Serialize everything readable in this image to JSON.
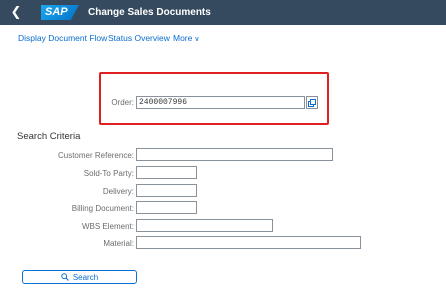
{
  "shell": {
    "logo_text": "SAP",
    "title": "Change Sales Documents"
  },
  "toolbar": {
    "document_flow": "Display Document Flow",
    "status_overview": "Status Overview",
    "more": "More"
  },
  "order": {
    "label": "Order:",
    "value": "2400007996"
  },
  "search_criteria": {
    "title": "Search Criteria",
    "fields": [
      {
        "label": "Customer Reference:",
        "value": ""
      },
      {
        "label": "Sold-To Party:",
        "value": ""
      },
      {
        "label": "Delivery:",
        "value": ""
      },
      {
        "label": "Billing Document:",
        "value": ""
      },
      {
        "label": "WBS Element:",
        "value": ""
      },
      {
        "label": "Material:",
        "value": ""
      }
    ],
    "search_button": "Search"
  },
  "colors": {
    "shell": "#354a5f",
    "link": "#0a6ed1",
    "highlight": "#e02020"
  }
}
